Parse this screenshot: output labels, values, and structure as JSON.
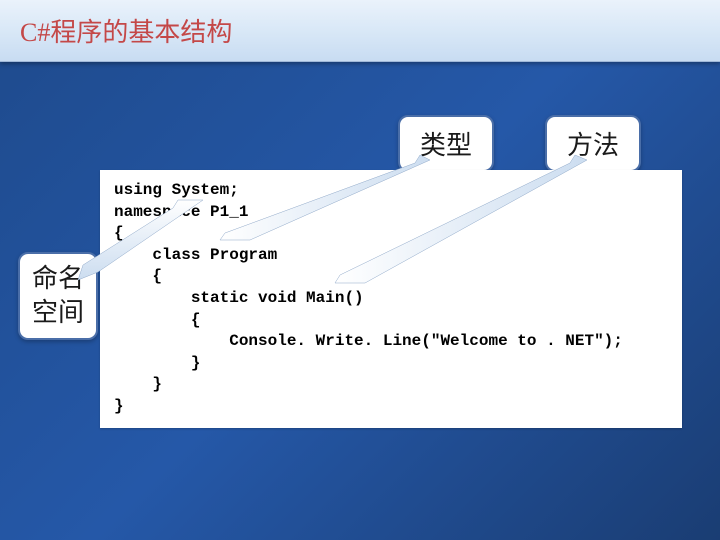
{
  "header": {
    "title": "C#程序的基本结构"
  },
  "labels": {
    "type": "类型",
    "method": "方法",
    "namespace_line1": "命名",
    "namespace_line2": "空间"
  },
  "code": {
    "line1": "using System;",
    "line2": "namespace P1_1",
    "line3": "{",
    "line4": "    class Program",
    "line5": "    {",
    "line6": "        static void Main()",
    "line7": "        {",
    "line8": "            Console. Write. Line(\"Welcome to . NET\");",
    "line9": "        }",
    "line10": "    }",
    "line11": "}"
  }
}
